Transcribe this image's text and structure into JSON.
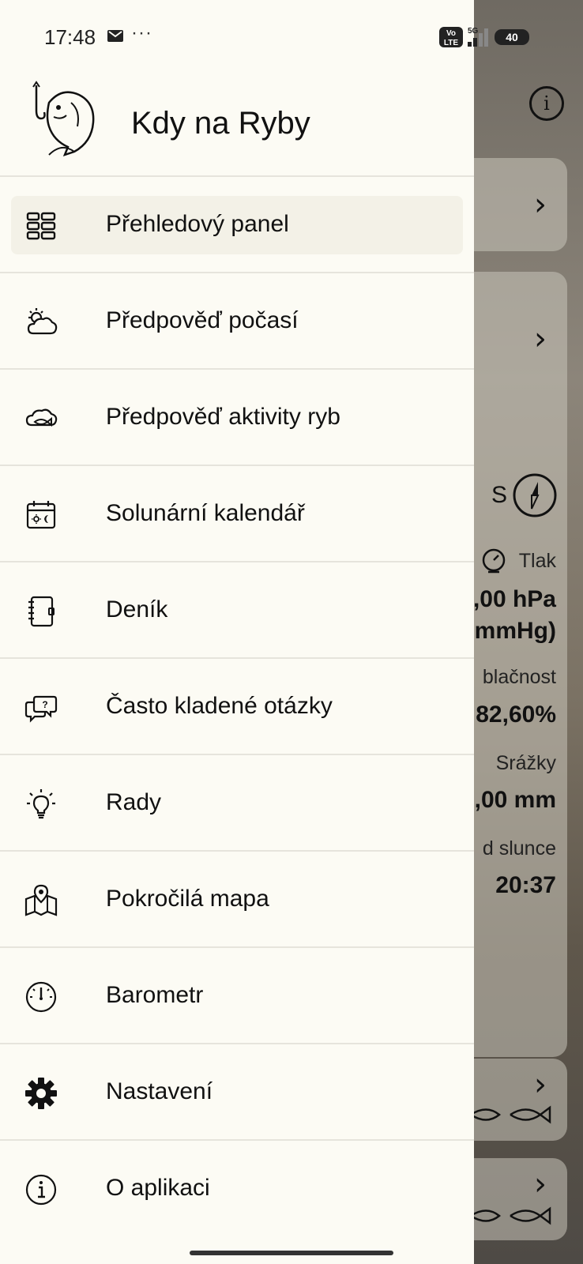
{
  "status_bar": {
    "time": "17:48",
    "more": "···",
    "network_badge": "Vo LTE",
    "network_type": "5G",
    "battery": "40"
  },
  "drawer": {
    "app_title": "Kdy na Ryby",
    "items": [
      {
        "label": "Přehledový panel",
        "icon": "dashboard-icon"
      },
      {
        "label": "Předpověď počasí",
        "icon": "weather-icon"
      },
      {
        "label": "Předpověď aktivity ryb",
        "icon": "fish-activity-icon"
      },
      {
        "label": "Solunární kalendář",
        "icon": "calendar-icon"
      },
      {
        "label": "Deník",
        "icon": "journal-icon"
      },
      {
        "label": "Často kladené otázky",
        "icon": "faq-icon"
      },
      {
        "label": "Rady",
        "icon": "lightbulb-icon"
      },
      {
        "label": "Pokročilá mapa",
        "icon": "map-icon"
      },
      {
        "label": "Barometr",
        "icon": "barometer-icon"
      },
      {
        "label": "Nastavení",
        "icon": "gear-icon"
      },
      {
        "label": "O aplikaci",
        "icon": "info-icon"
      }
    ]
  },
  "background": {
    "wind_direction": "S",
    "pressure_label": "Tlak",
    "pressure_value": ",00 hPa",
    "pressure_mmhg": "mmHg)",
    "cloud_label": "blačnost",
    "cloud_value": "82,60%",
    "rain_label": "Srážky",
    "rain_value": ",00 mm",
    "sun_label": "d slunce",
    "sun_value": "20:37"
  },
  "colors": {
    "drawer_bg": "#fcfbf4",
    "active_item_bg": "#f3f1e7",
    "text": "#111111"
  }
}
